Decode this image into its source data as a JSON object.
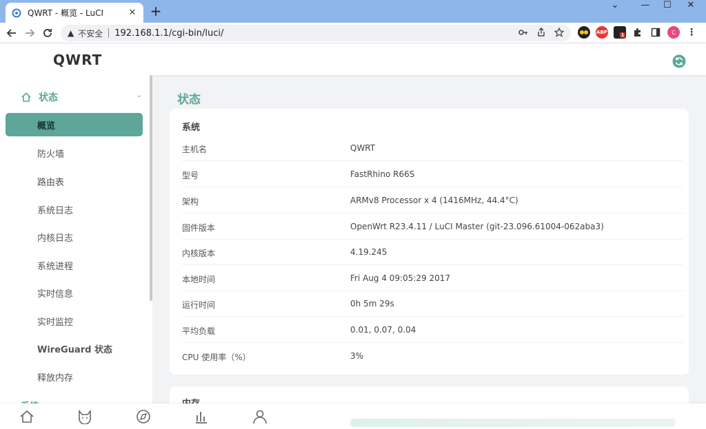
{
  "browser": {
    "tab_title": "QWRT - 概览 - LuCI",
    "not_secure": "不安全",
    "url": "192.168.1.1/cgi-bin/luci/"
  },
  "header": {
    "brand": "QWRT"
  },
  "sidebar": {
    "group_label": "状态",
    "items": [
      {
        "label": "概览"
      },
      {
        "label": "防火墙"
      },
      {
        "label": "路由表"
      },
      {
        "label": "系统日志"
      },
      {
        "label": "内核日志"
      },
      {
        "label": "系统进程"
      },
      {
        "label": "实时信息"
      },
      {
        "label": "实时监控"
      },
      {
        "label": "WireGuard 状态"
      },
      {
        "label": "释放内存"
      }
    ],
    "next_group": "系统"
  },
  "main": {
    "title": "状态",
    "system_card": {
      "title": "系统",
      "rows": [
        {
          "key": "主机名",
          "value": "QWRT"
        },
        {
          "key": "型号",
          "value": "FastRhino R66S"
        },
        {
          "key": "架构",
          "value": "ARMv8 Processor x 4 (1416MHz, 44.4°C)"
        },
        {
          "key": "固件版本",
          "value": "OpenWrt R23.4.11 / LuCI Master (git-23.096.61004-062aba3)"
        },
        {
          "key": "内核版本",
          "value": "4.19.245"
        },
        {
          "key": "本地时间",
          "value": "Fri Aug 4 09:05:29 2017"
        },
        {
          "key": "运行时间",
          "value": "0h 5m 29s"
        },
        {
          "key": "平均负载",
          "value": "0.01, 0.07, 0.04"
        },
        {
          "key": "CPU 使用率（%）",
          "value": "3%"
        }
      ]
    },
    "memory_card": {
      "title": "内存"
    }
  },
  "colors": {
    "accent": "#5ea69a",
    "chrome": "#8fb6e8"
  }
}
